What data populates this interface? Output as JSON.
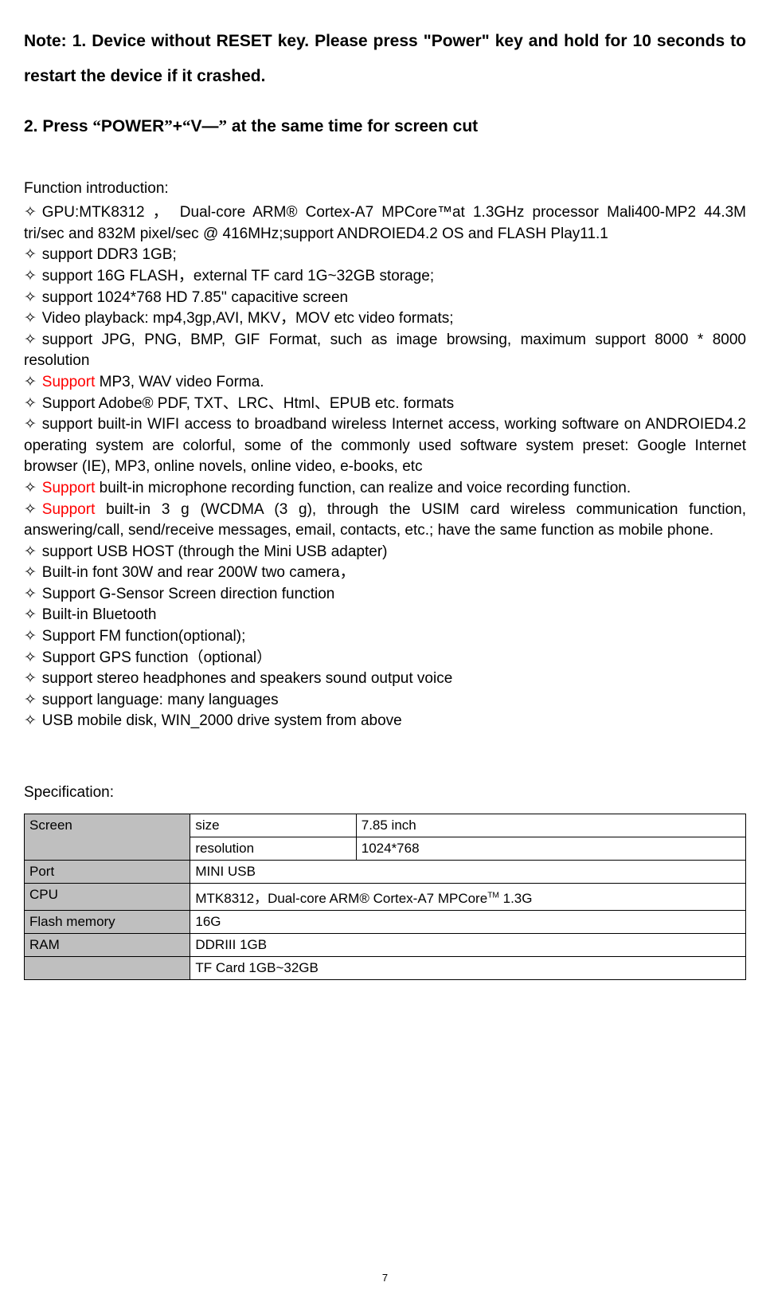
{
  "note1": "Note: 1. Device without RESET key. Please press \"Power\" key and hold for 10 seconds to restart the device if it crashed.",
  "note2_prefix": "2. Press  ",
  "note2_q1_open": "“",
  "note2_power": "POWER",
  "note2_q1_close": "”",
  "note2_plus": "+",
  "note2_q2_open": "“",
  "note2_v": "V",
  "note2_dash": "—",
  "note2_q2_close": "”",
  "note2_suffix": "  at the same time for screen cut",
  "func_title": "Function introduction:",
  "bullets": [
    {
      "pre": "GPU:MTK8312 ， Dual-core ARM® Cortex-A7 MPCore™at 1.3GHz processor Mali400-MP2  44.3M tri/sec and 832M pixel/sec @ 416MHz;support ANDROIED4.2 OS and FLASH Play11.1"
    },
    {
      "pre": "support  DDR3 1GB;"
    },
    {
      "pre": "support 16G FLASH，external TF card 1G~32GB storage;"
    },
    {
      "pre": "support 1024*768 HD 7.85'' capacitive screen"
    },
    {
      "pre": "Video playback: mp4,3gp,AVI, MKV，MOV etc video formats;"
    },
    {
      "pre": "support JPG, PNG, BMP, GIF Format, such as image browsing, maximum support 8000 * 8000 resolution"
    },
    {
      "red": "Support",
      "post": " MP3, WAV video Forma."
    },
    {
      "pre": "Support Adobe® PDF, TXT、LRC、Html、EPUB etc. formats"
    },
    {
      "pre": "support built-in WIFI access to broadband wireless Internet access, working software on ANDROIED4.2 operating system are colorful, some of the commonly used software system preset: Google Internet browser (IE), MP3, online novels, online video, e-books, etc"
    },
    {
      "red": "Support",
      "post": " built-in microphone recording function, can realize and voice recording function."
    },
    {
      "red": "Support",
      "post": " built-in 3 g (WCDMA (3 g), through the USIM card wireless communication function, answering/call, send/receive messages, email, contacts, etc.; have the same function as mobile phone."
    },
    {
      "pre": "support USB HOST (through the Mini USB adapter)"
    },
    {
      "pre": "Built-in font 30W and rear 200W two camera，"
    },
    {
      "pre": "Support G-Sensor Screen direction function"
    },
    {
      "pre": "Built-in Bluetooth"
    },
    {
      "pre": "Support FM function(optional);"
    },
    {
      "pre": "Support GPS function（optional）"
    },
    {
      "pre": "support stereo headphones and speakers sound output voice"
    },
    {
      "pre": "support language: many languages"
    },
    {
      "pre": "USB mobile disk, WIN_2000 drive system from above"
    }
  ],
  "diamond": "✧",
  "spec_title": "Specification:",
  "table": {
    "screen": {
      "label": "Screen",
      "size_k": "size",
      "size_v": "7.85 inch",
      "res_k": "resolution",
      "res_v": "1024*768"
    },
    "port": {
      "label": "Port",
      "val": "MINI USB"
    },
    "cpu": {
      "label": "CPU",
      "val_pre": "MTK8312，Dual-core ARM® Cortex-A7 MPCore",
      "val_tm": "TM",
      "val_post": " 1.3G"
    },
    "flash": {
      "label": "Flash memory",
      "val": "16G"
    },
    "ram": {
      "label": "RAM",
      "val": "DDRIII  1GB"
    },
    "tf": {
      "label": "",
      "val": "TF Card 1GB~32GB"
    }
  },
  "pagenum": "7"
}
